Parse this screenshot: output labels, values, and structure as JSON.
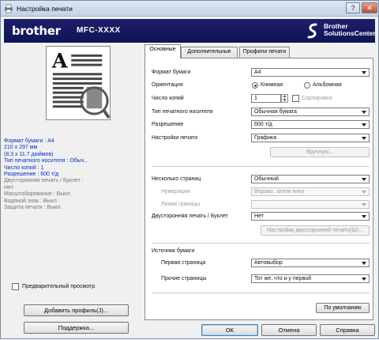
{
  "window": {
    "title": "Настройка печати",
    "help_glyph": "?",
    "close_glyph": "✕"
  },
  "brand": {
    "logo": "brother",
    "model": "MFC-XXXX",
    "solutions_line1": "Brother",
    "solutions_line2": "SolutionsCenter"
  },
  "summary": {
    "paper_size": "Формат бумаги : A4",
    "dimensions_mm": "210 x 297 мм",
    "dimensions_in": "(8.3 x 11.7 дюймов)",
    "media_type": "Тип печатного носителя : Обыч...",
    "copies": "Число копий : 1",
    "resolution": "Разрешение : 600 т/д",
    "duplex_label": "Двусторонняя печать / Буклет :",
    "duplex_value": "Нет",
    "scaling": "Масштабирование : Выкл.",
    "watermark": "Водяной знак : Выкл.",
    "secure": "Защита печати : Выкл."
  },
  "left": {
    "preview_checkbox_label": "Предварительный просмотр",
    "preview_checked": false,
    "add_profile_button": "Добавить профиль(J)...",
    "support_button": "Поддержка..."
  },
  "tabs": [
    {
      "label": "Основные",
      "active": true
    },
    {
      "label": "Дополнительные",
      "active": false
    },
    {
      "label": "Профили печати",
      "active": false
    }
  ],
  "basic": {
    "paper_size_label": "Формат бумаги",
    "paper_size_value": "A4",
    "orientation_label": "Ориентация",
    "portrait_label": "Книжная",
    "landscape_label": "Альбомная",
    "orientation_selected": "portrait",
    "copies_label": "Число копий",
    "copies_value": "1",
    "collate_label": "Сортировка",
    "collate_checked": false,
    "media_type_label": "Тип печатного носителя",
    "media_type_value": "Обычная бумага",
    "resolution_label": "Разрешение",
    "resolution_value": "600 т/д",
    "print_settings_label": "Настройки печати",
    "print_settings_value": "Графика",
    "manual_button": "Вручную...",
    "multiple_pages_label": "Несколько страниц",
    "multiple_pages_value": "Обычный",
    "page_order_label": "Нумерация",
    "page_order_value": "Вправо, затем вниз",
    "border_line_label": "Линия границы",
    "border_line_value": "",
    "duplex_label": "Двусторонняя печать / Буклет",
    "duplex_value": "Нет",
    "duplex_settings_button": "Настройки двусторонней печати(Ш)...",
    "paper_source_label": "Источник бумаги",
    "first_page_label": "Первая страница",
    "first_page_value": "Автовыбор",
    "other_pages_label": "Прочие страницы",
    "other_pages_value": "Тот же, что и у первой",
    "default_button": "По умолчанию"
  },
  "footer": {
    "ok": "OK",
    "cancel": "Отмена",
    "help": "Справка"
  }
}
